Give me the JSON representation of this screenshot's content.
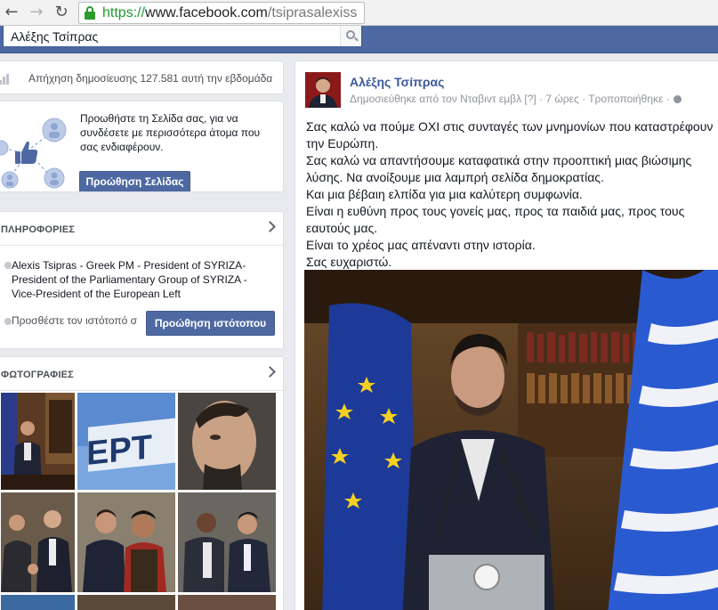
{
  "browser": {
    "url_scheme": "https://",
    "url_host": "www.facebook.com",
    "url_path": "/tsiprasalexiss"
  },
  "search": {
    "value": "Αλέξης Τσίπρας"
  },
  "reach": {
    "text": "Απήχηση δημοσίευσης 127.581 αυτή την εβδομάδα"
  },
  "promote_page": {
    "text": "Προωθήστε τη Σελίδα σας, για να συνδέσετε με περισσότερα άτομα που σας ενδιαφέρουν.",
    "button": "Προώθηση Σελίδας"
  },
  "info": {
    "title": "ΠΛΗΡΟΦΟΡΙΕΣ",
    "description": "Alexis Tsipras - Greek PM - President of SYRIZA- President of the Parliamentary Group of SYRIZA - Vice-President of the European Left",
    "site_prompt": "Προσθέστε τον ιστότοπό σ",
    "site_button": "Προώθηση ιστότοπου"
  },
  "photos": {
    "title": "ΦΩΤΟΓΡΑΦΙΕΣ"
  },
  "post": {
    "author": "Αλέξης Τσίπρας",
    "meta": "Δημοσιεύθηκε από τον Νταβιντ εμβλ [?] · 7 ώρες · Τροποποιήθηκε ·",
    "lines": [
      "Σας καλώ να πούμε ΟΧΙ στις συνταγές των μνημονίων που καταστρέφουν την Ευρώπη.",
      "Σας καλώ να απαντήσουμε καταφατικά στην προοπτική μιας βιώσιμης λύσης. Να ανοίξουμε μια λαμπρή σελίδα δημοκρατίας.",
      "Και μια βέβαιη ελπίδα για μια καλύτερη συμφωνία.",
      "Είναι η ευθύνη προς τους γονείς μας, προς τα παιδιά μας, προς τους εαυτούς μας.",
      "Είναι το χρέος μας απέναντι στην ιστορία.",
      "Σας ευχαριστώ."
    ]
  },
  "colors": {
    "fb_blue": "#4e69a2",
    "link_blue": "#3b5998",
    "secure_green": "#1f9a2e"
  }
}
